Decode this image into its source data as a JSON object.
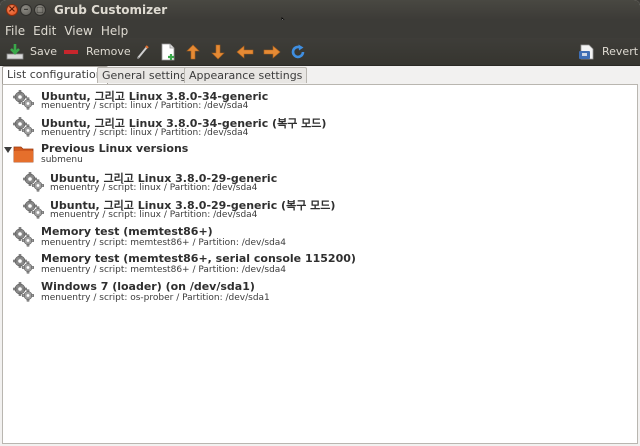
{
  "window": {
    "title": "Grub Customizer"
  },
  "menu": [
    "File",
    "Edit",
    "View",
    "Help"
  ],
  "toolbar": {
    "save_label": "Save",
    "remove_label": "Remove",
    "revert_label": "Revert"
  },
  "tabs": [
    "List configuration",
    "General settings",
    "Appearance settings"
  ],
  "entries": [
    {
      "name": "Ubuntu, 그리고 Linux 3.8.0-34-generic",
      "sub": "menuentry / script: linux / Partition: /dev/sda4"
    },
    {
      "name": "Ubuntu, 그리고 Linux 3.8.0-34-generic (복구 모드)",
      "sub": "menuentry / script: linux / Partition: /dev/sda4"
    },
    {
      "name": "Previous Linux versions",
      "sub": "submenu"
    },
    {
      "name": "Ubuntu, 그리고 Linux 3.8.0-29-generic",
      "sub": "menuentry / script: linux / Partition: /dev/sda4"
    },
    {
      "name": "Ubuntu, 그리고 Linux 3.8.0-29-generic (복구 모드)",
      "sub": "menuentry / script: linux / Partition: /dev/sda4"
    },
    {
      "name": "Memory test (memtest86+)",
      "sub": "menuentry / script: memtest86+ / Partition: /dev/sda4"
    },
    {
      "name": "Memory test (memtest86+, serial console 115200)",
      "sub": "menuentry / script: memtest86+ / Partition: /dev/sda4"
    },
    {
      "name": "Windows 7 (loader) (on /dev/sda1)",
      "sub": "menuentry / script: os-prober / Partition: /dev/sda1"
    }
  ],
  "colors": {
    "titlebar": "#3c3b37",
    "close_button": "#df4a16",
    "arrow": "#e58a35",
    "folder": "#d25a1e"
  }
}
